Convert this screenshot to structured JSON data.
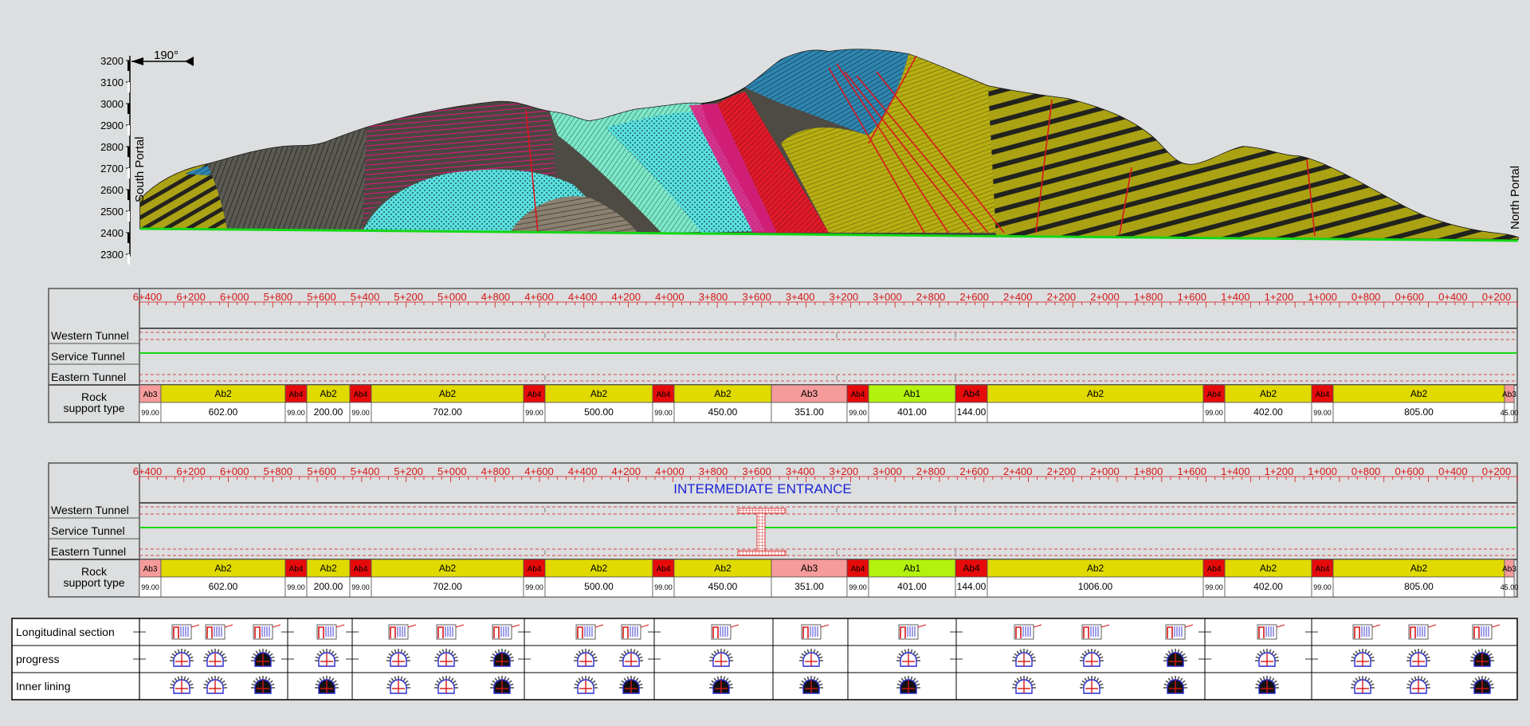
{
  "profile": {
    "south_portal": "South Portal",
    "north_portal": "North Portal",
    "bearing": "190°",
    "elevation_ticks": [
      "3200",
      "3100",
      "3000",
      "2900",
      "2800",
      "2700",
      "2600",
      "2500",
      "2400",
      "2300"
    ]
  },
  "chainage_labels": [
    "6+400",
    "6+200",
    "6+000",
    "5+800",
    "5+600",
    "5+400",
    "5+200",
    "5+000",
    "4+800",
    "4+600",
    "4+400",
    "4+200",
    "4+000",
    "3+800",
    "3+600",
    "3+400",
    "3+200",
    "3+000",
    "2+800",
    "2+600",
    "2+400",
    "2+200",
    "2+000",
    "1+800",
    "1+600",
    "1+400",
    "1+200",
    "1+000",
    "0+800",
    "0+600",
    "0+400",
    "0+200"
  ],
  "panel1": {
    "rows": [
      "Western Tunnel",
      "Service Tunnel",
      "Eastern Tunnel"
    ],
    "rock_label": "Rock\nsupport type",
    "segments": [
      {
        "type": "Ab3",
        "length": "99.00"
      },
      {
        "type": "Ab2",
        "length": "602.00"
      },
      {
        "type": "Ab4",
        "length": "99.00"
      },
      {
        "type": "Ab2",
        "length": "200.00"
      },
      {
        "type": "Ab4",
        "length": "99.00"
      },
      {
        "type": "Ab2",
        "length": "702.00"
      },
      {
        "type": "Ab4",
        "length": "99.00"
      },
      {
        "type": "Ab2",
        "length": "500.00"
      },
      {
        "type": "Ab4",
        "length": "99.00"
      },
      {
        "type": "Ab2",
        "length": "450.00"
      },
      {
        "type": "Ab3",
        "length": "351.00"
      },
      {
        "type": "Ab4",
        "length": "99.00"
      },
      {
        "type": "Ab1",
        "length": "401.00"
      },
      {
        "type": "Ab4",
        "length": "144.00"
      },
      {
        "type": "Ab2",
        "length": ""
      },
      {
        "type": "Ab4",
        "length": "99.00"
      },
      {
        "type": "Ab2",
        "length": "402.00"
      },
      {
        "type": "Ab4",
        "length": "99.00"
      },
      {
        "type": "Ab2",
        "length": "805.00"
      },
      {
        "type": "Ab3",
        "length": "45.00"
      }
    ]
  },
  "panel2": {
    "title": "INTERMEDIATE ENTRANCE",
    "rows": [
      "Western Tunnel",
      "Service Tunnel",
      "Eastern Tunnel"
    ],
    "rock_label": "Rock\nsupport type",
    "segments": [
      {
        "type": "Ab3",
        "length": "99.00"
      },
      {
        "type": "Ab2",
        "length": "602.00"
      },
      {
        "type": "Ab4",
        "length": "99.00"
      },
      {
        "type": "Ab2",
        "length": "200.00"
      },
      {
        "type": "Ab4",
        "length": "99.00"
      },
      {
        "type": "Ab2",
        "length": "702.00"
      },
      {
        "type": "Ab4",
        "length": "99.00"
      },
      {
        "type": "Ab2",
        "length": "500.00"
      },
      {
        "type": "Ab4",
        "length": "99.00"
      },
      {
        "type": "Ab2",
        "length": "450.00"
      },
      {
        "type": "Ab3",
        "length": "351.00"
      },
      {
        "type": "Ab4",
        "length": "99.00"
      },
      {
        "type": "Ab1",
        "length": "401.00"
      },
      {
        "type": "Ab4",
        "length": "144.00"
      },
      {
        "type": "Ab2",
        "length": "1006.00"
      },
      {
        "type": "Ab4",
        "length": "99.00"
      },
      {
        "type": "Ab2",
        "length": "402.00"
      },
      {
        "type": "Ab4",
        "length": "99.00"
      },
      {
        "type": "Ab2",
        "length": "805.00"
      },
      {
        "type": "Ab3",
        "length": "45.00"
      }
    ]
  },
  "legend": {
    "rows": [
      "Longitudinal section",
      "progress",
      "Inner lining"
    ]
  },
  "colors": {
    "Ab1": "#b3f20f",
    "Ab2": "#e0da00",
    "Ab3": "#f59b9b",
    "Ab4": "#e60b0b",
    "grid_red": "#d61515",
    "service_line": "#16d616",
    "title_blue": "#1a22d8"
  }
}
